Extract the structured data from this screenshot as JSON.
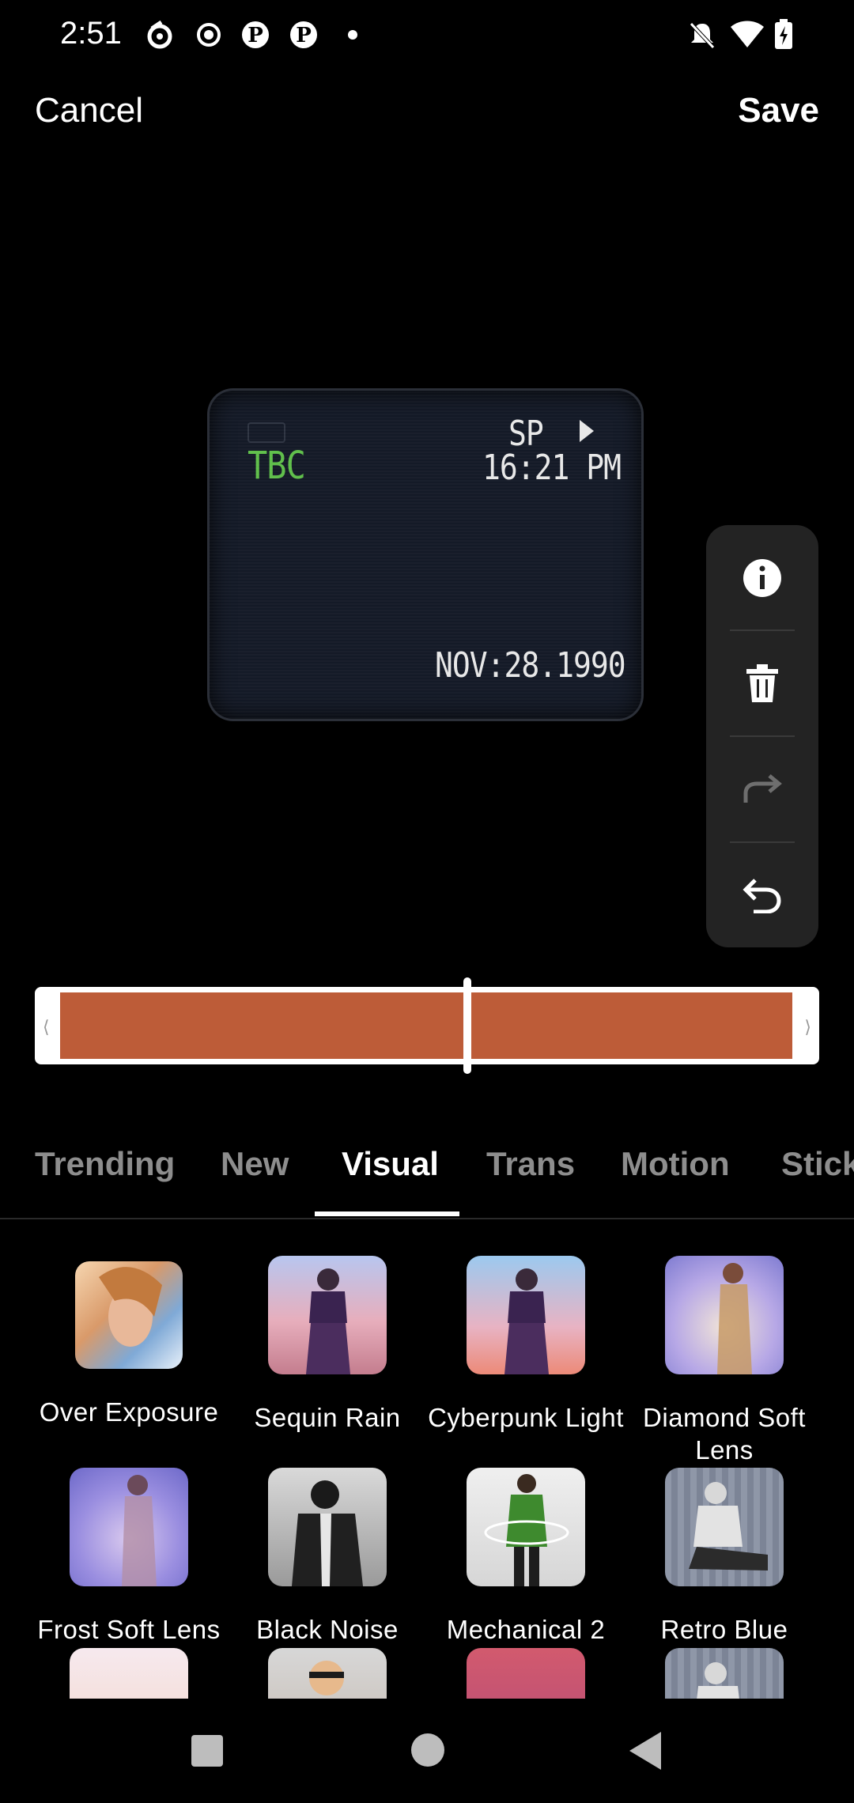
{
  "status": {
    "time": "2:51"
  },
  "topbar": {
    "cancel_label": "Cancel",
    "save_label": "Save"
  },
  "preview": {
    "osd_tbc": "TBC",
    "osd_sp": "SP",
    "osd_time": "16:21 PM",
    "osd_date": "NOV:28.1990"
  },
  "timeline": {
    "handle_left": "⟨",
    "handle_right": "⟩",
    "color": "#bd5c38",
    "playhead_position": 0.55
  },
  "tabs": [
    {
      "label": "Trending"
    },
    {
      "label": "New"
    },
    {
      "label": "Visual",
      "active": true
    },
    {
      "label": "Trans"
    },
    {
      "label": "Motion"
    },
    {
      "label": "Stick"
    }
  ],
  "effects": [
    {
      "label": "Over Exposure",
      "icon": "over-exposure-thumb"
    },
    {
      "label": "Sequin Rain",
      "icon": "sequin-rain-thumb"
    },
    {
      "label": "Cyberpunk Light",
      "icon": "cyberpunk-light-thumb"
    },
    {
      "label": "Diamond Soft Lens",
      "icon": "diamond-soft-lens-thumb"
    },
    {
      "label": "Frost Soft Lens",
      "icon": "frost-soft-lens-thumb"
    },
    {
      "label": "Black Noise",
      "icon": "black-noise-thumb"
    },
    {
      "label": "Mechanical 2",
      "icon": "mechanical-2-thumb"
    },
    {
      "label": "Retro Blue",
      "icon": "retro-blue-thumb"
    }
  ],
  "tools": [
    "info-icon",
    "trash-icon",
    "redo-icon",
    "undo-icon"
  ]
}
